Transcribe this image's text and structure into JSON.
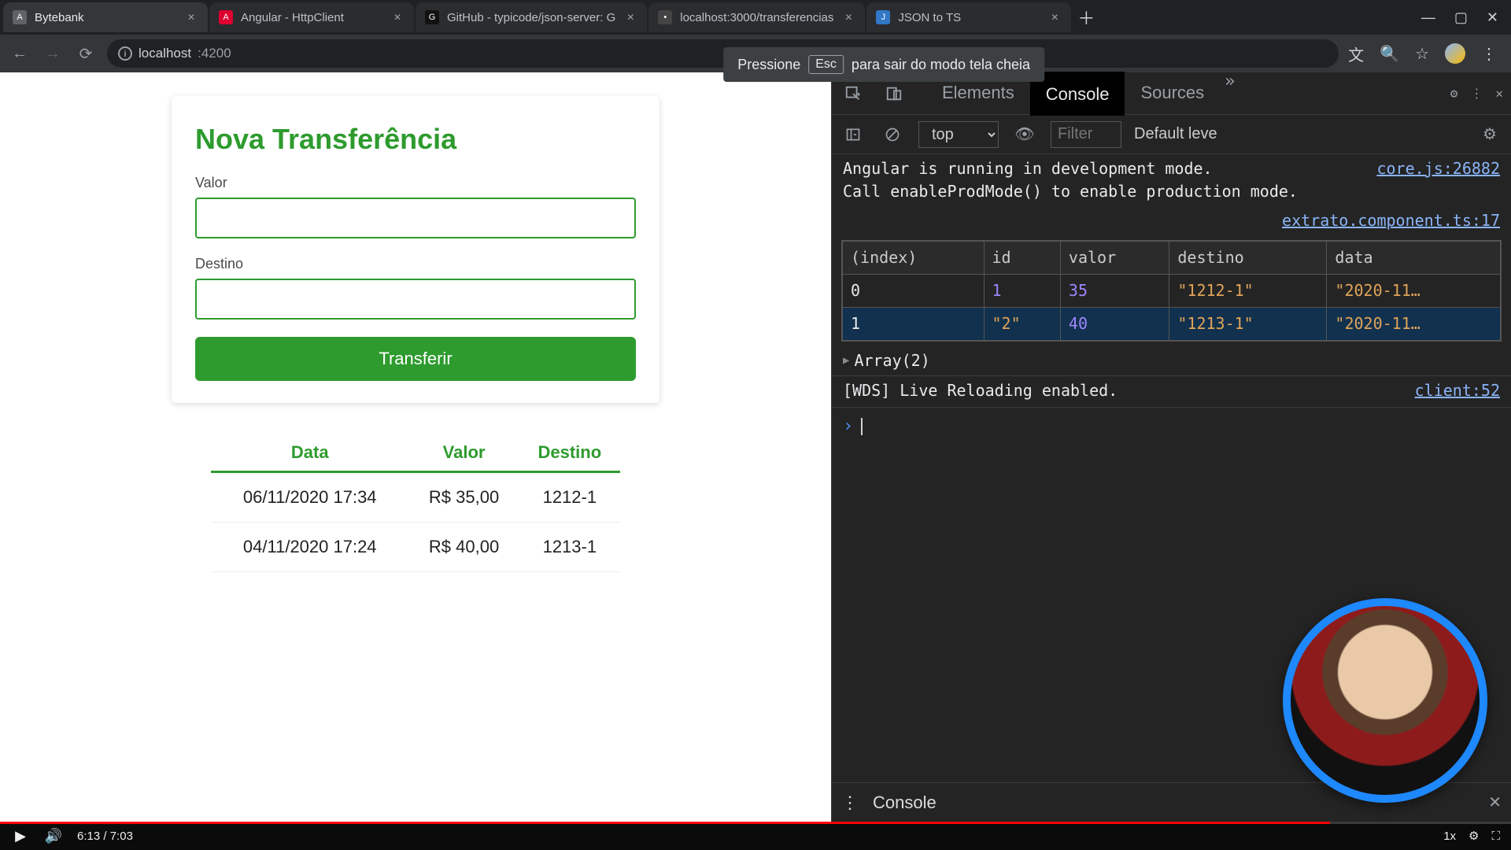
{
  "browser": {
    "tabs": [
      {
        "title": "Bytebank",
        "favicon": "A",
        "active": true
      },
      {
        "title": "Angular - HttpClient",
        "favicon": "A"
      },
      {
        "title": "GitHub - typicode/json-server: G",
        "favicon": "G"
      },
      {
        "title": "localhost:3000/transferencias",
        "favicon": "•"
      },
      {
        "title": "JSON to TS",
        "favicon": "J"
      }
    ],
    "url_host": "localhost",
    "url_port": ":4200"
  },
  "fs_hint": {
    "before": "Pressione",
    "key": "Esc",
    "after": "para sair do modo tela cheia"
  },
  "app": {
    "form": {
      "title": "Nova Transferência",
      "valor_label": "Valor",
      "valor_value": "",
      "destino_label": "Destino",
      "destino_value": "",
      "submit_label": "Transferir"
    },
    "extrato": {
      "headers": {
        "data": "Data",
        "valor": "Valor",
        "destino": "Destino"
      },
      "rows": [
        {
          "data": "06/11/2020 17:34",
          "valor": "R$ 35,00",
          "destino": "1212-1"
        },
        {
          "data": "04/11/2020 17:24",
          "valor": "R$ 40,00",
          "destino": "1213-1"
        }
      ]
    }
  },
  "devtools": {
    "tabs": {
      "elements": "Elements",
      "console": "Console",
      "sources": "Sources"
    },
    "toolbar": {
      "context": "top",
      "filter_placeholder": "Filter",
      "level": "Default leve"
    },
    "log1_a": "Angular is running in development mode.",
    "log1_b": "Call enableProdMode() to enable production mode.",
    "log1_src": "core.js:26882",
    "table_src": "extrato.component.ts:17",
    "table": {
      "headers": [
        "(index)",
        "id",
        "valor",
        "destino",
        "data"
      ],
      "rows": [
        {
          "index": "0",
          "id": "1",
          "id_is_num": true,
          "valor": "35",
          "destino": "\"1212-1\"",
          "data": "\"2020-11…"
        },
        {
          "index": "1",
          "id": "\"2\"",
          "id_is_num": false,
          "valor": "40",
          "destino": "\"1213-1\"",
          "data": "\"2020-11…"
        }
      ]
    },
    "array_line": "Array(2)",
    "log2": "[WDS] Live Reloading enabled.",
    "log2_src": "client:52",
    "drawer_label": "Console"
  },
  "video": {
    "progress_pct": 88,
    "time_current": "6:13",
    "time_total": "7:03",
    "quality": "1x"
  }
}
